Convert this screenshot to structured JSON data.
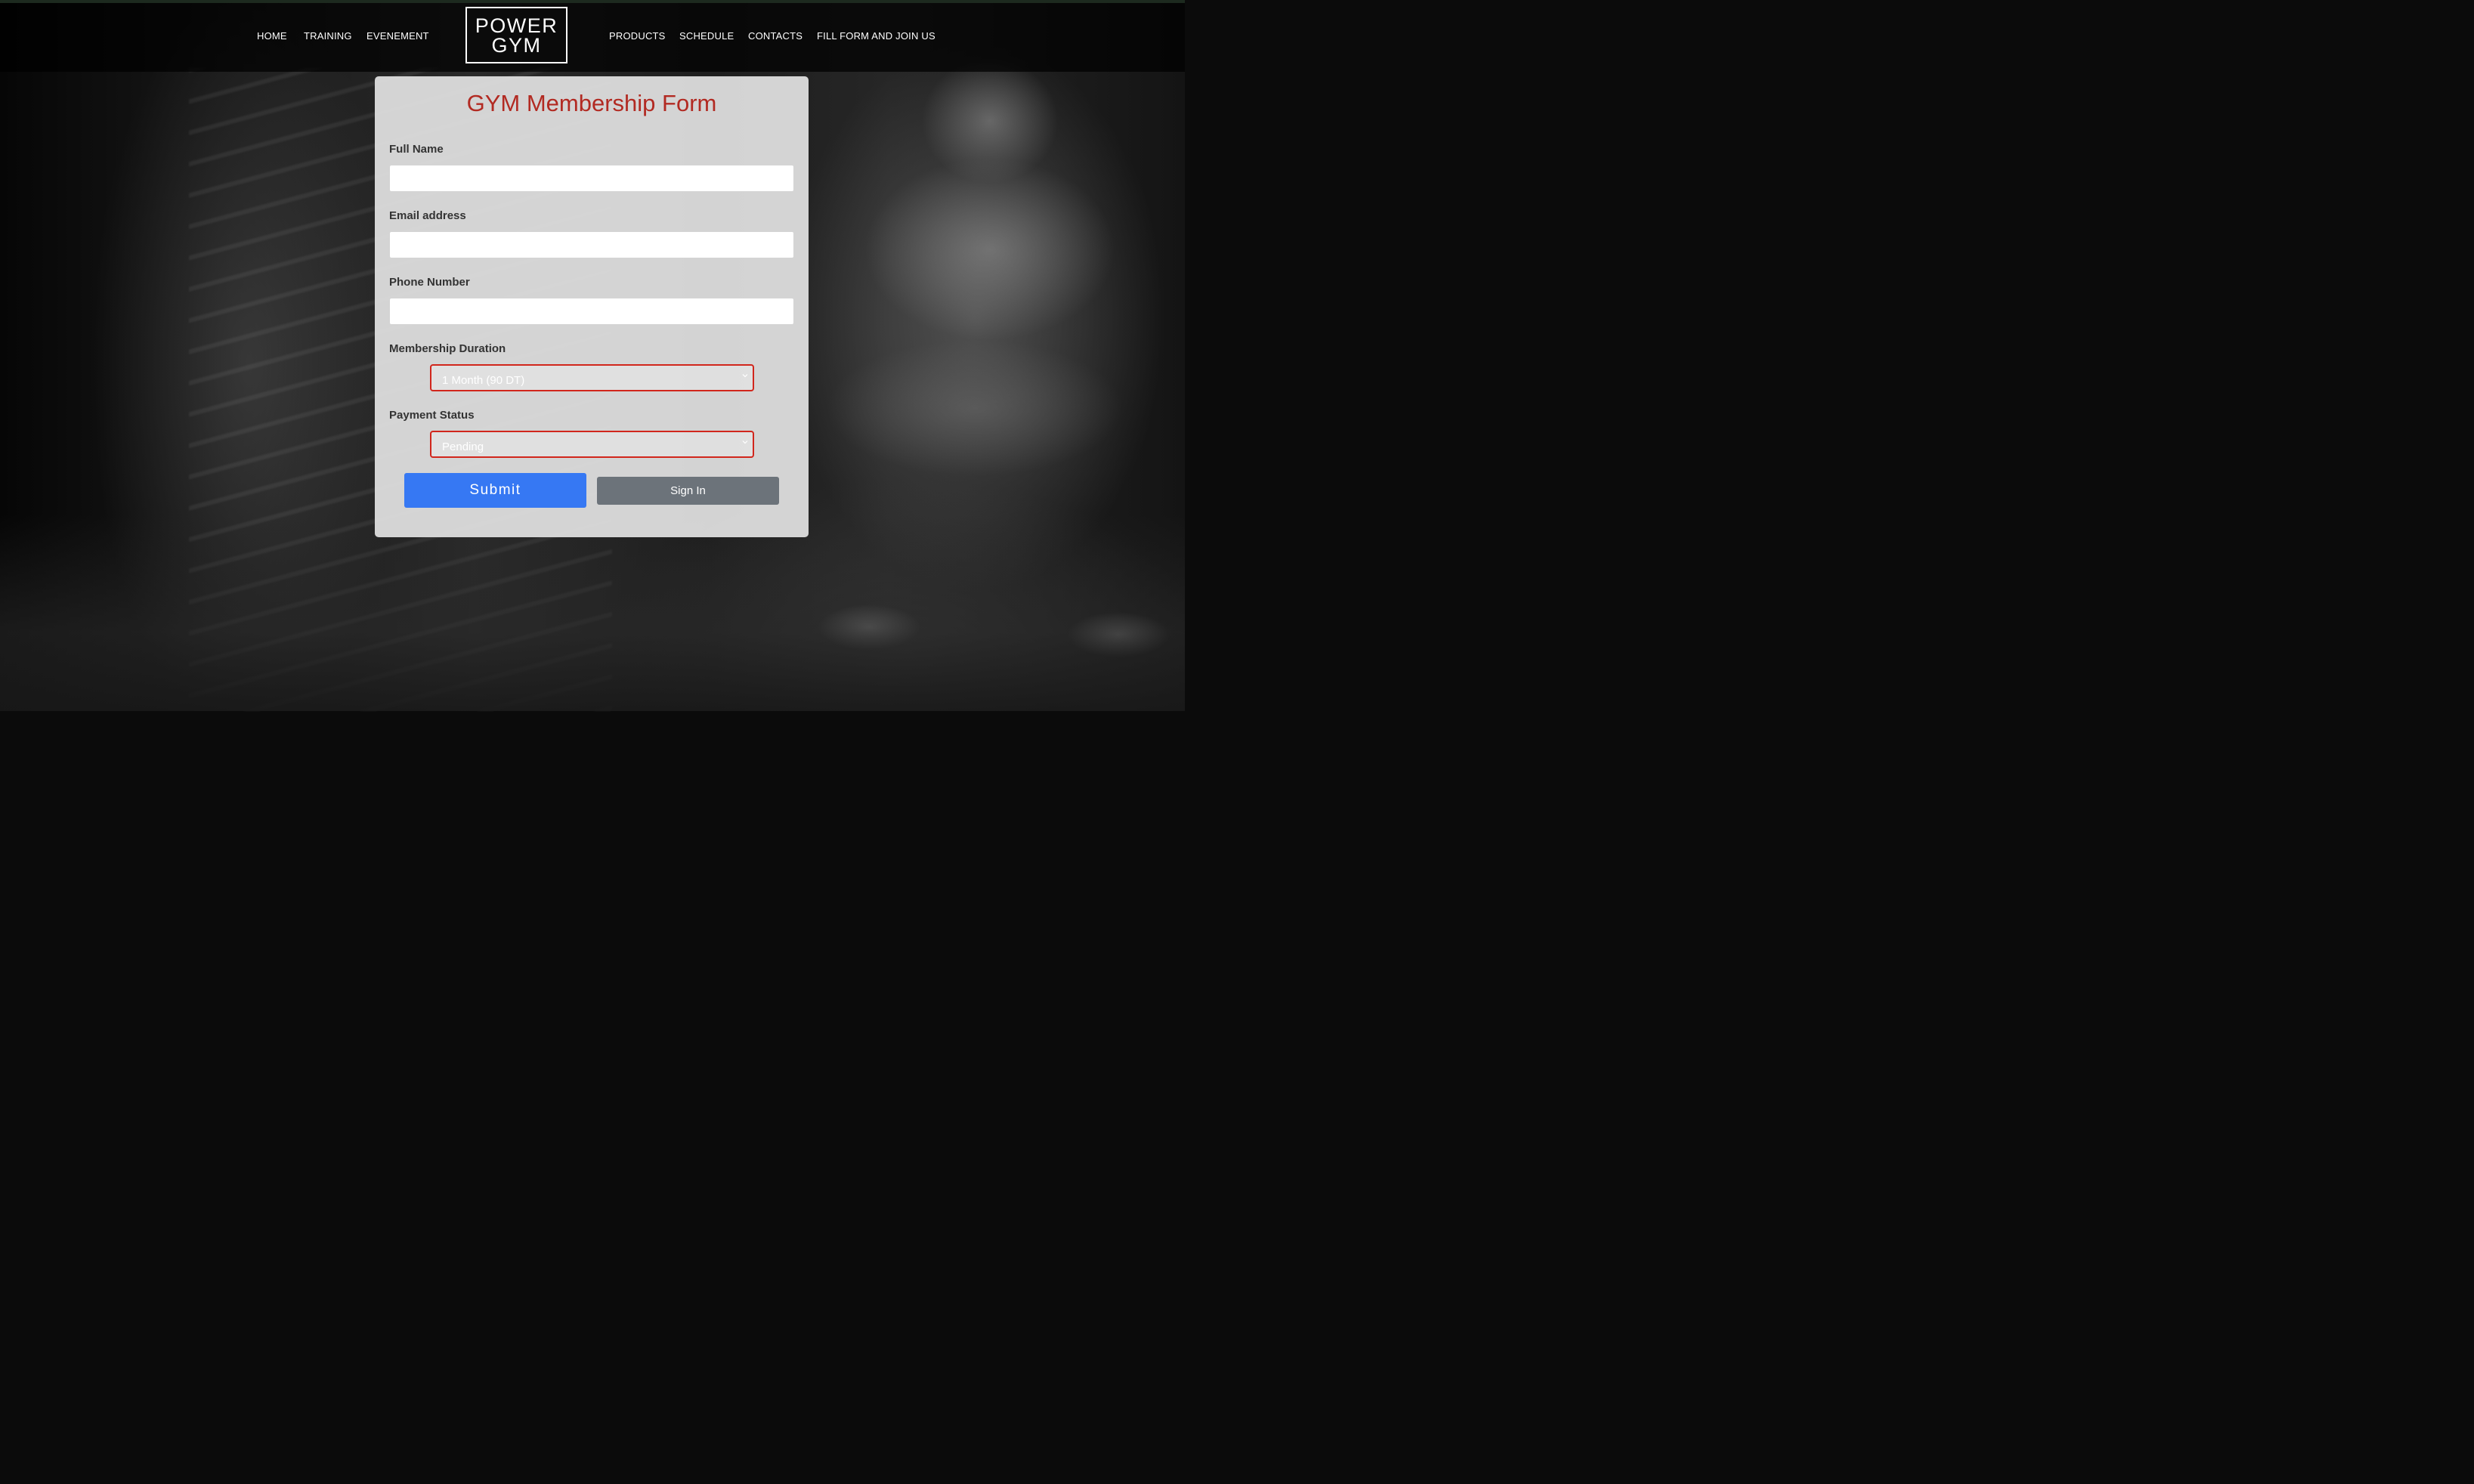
{
  "brand": {
    "line1": "POWER",
    "line2": "GYM"
  },
  "nav": {
    "left": [
      "HOME",
      "TRAINING",
      "EVENEMENT"
    ],
    "right": [
      "PRODUCTS",
      "SCHEDULE",
      "CONTACTS",
      "FILL FORM AND JOIN US"
    ]
  },
  "form": {
    "title": "GYM Membership Form",
    "fields": {
      "full_name": {
        "label": "Full Name",
        "value": ""
      },
      "email": {
        "label": "Email address",
        "value": ""
      },
      "phone": {
        "label": "Phone Number",
        "value": ""
      },
      "duration": {
        "label": "Membership Duration",
        "selected": "1 Month (90 DT)"
      },
      "payment": {
        "label": "Payment Status",
        "selected": "Pending"
      }
    },
    "submit_label": "Submit",
    "signin_label": "Sign In"
  },
  "colors": {
    "title": "#b22a22",
    "select_border": "#d1261c",
    "submit_bg": "#3678f3",
    "signin_bg": "#6c737a"
  },
  "icons": {
    "select_arrow": "chevron-down-icon"
  }
}
